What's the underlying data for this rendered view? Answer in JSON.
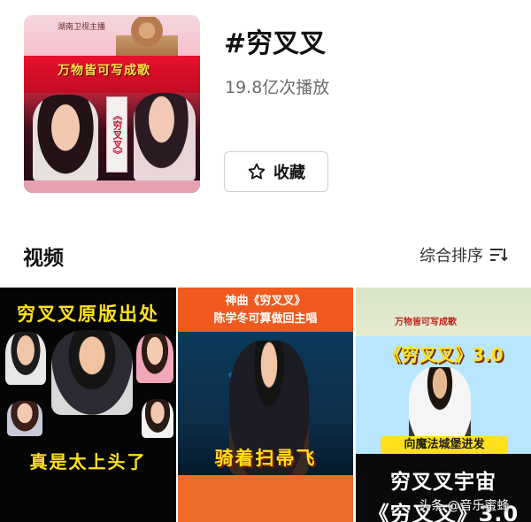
{
  "header": {
    "cover": {
      "top_label": "湖南卫视主播",
      "banner_text": "万物皆可写成歌",
      "vertical_title": "《穷叉叉》"
    },
    "tag_title": "#穷叉叉",
    "play_count": "19.8亿次播放",
    "favorite_label": "收藏",
    "favorite_icon": "star-outline-icon"
  },
  "section": {
    "title": "视频",
    "sort_label": "综合排序",
    "sort_icon": "sort-icon"
  },
  "videos": [
    {
      "top_text": "穷叉叉原版出处",
      "bottom_text": "真是太上头了"
    },
    {
      "header_line1": "神曲《穷叉叉》",
      "header_line2": "陈学冬可算做回主唱",
      "caption": "骑着扫帚飞"
    },
    {
      "banner": "万物皆可写成歌",
      "title": "《穷叉叉》3.0",
      "pill": "向魔法城堡进发",
      "bottom_line1": "穷叉叉宇宙",
      "bottom_line2": "《穷叉叉》3.0"
    }
  ],
  "watermark": "头条 @音乐蜜蜂"
}
